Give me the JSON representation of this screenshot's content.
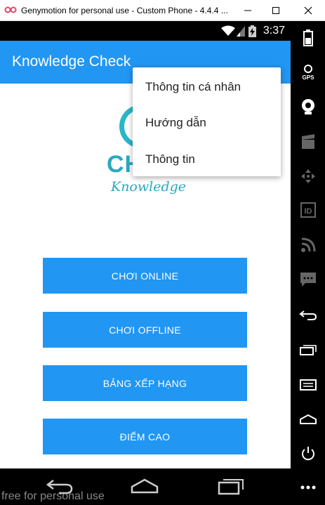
{
  "window": {
    "title": "Genymotion for personal use - Custom Phone - 4.4.4 ...",
    "controls": [
      "minimize-icon",
      "maximize-icon",
      "close-icon"
    ]
  },
  "status_bar": {
    "time": "3:37",
    "icons": [
      "wifi-icon",
      "signal-icon",
      "battery-charging-icon"
    ]
  },
  "app_bar": {
    "title": "Knowledge Check"
  },
  "logo": {
    "line1": "CHECK",
    "line2": "Knowledge"
  },
  "buttons": [
    {
      "label": "CHƠI ONLINE"
    },
    {
      "label": "CHƠI OFFLINE"
    },
    {
      "label": "BẢNG XẾP HẠNG"
    },
    {
      "label": "ĐIỂM CAO"
    }
  ],
  "popup_menu": {
    "items": [
      {
        "label": "Thông tin cá nhân"
      },
      {
        "label": "Hướng dẫn"
      },
      {
        "label": "Thông tin"
      }
    ]
  },
  "nav_bar": {
    "icons": [
      "back-icon",
      "home-icon",
      "recent-apps-icon"
    ]
  },
  "sidebar": {
    "icons": [
      "battery-icon",
      "gps-icon",
      "webcam-icon",
      "clapper-icon",
      "dpad-icon",
      "id-icon",
      "rss-icon",
      "sms-icon",
      "back-icon",
      "recent-apps-icon",
      "menu-icon",
      "home-icon",
      "power-icon",
      "more-icon"
    ],
    "gps_label": "GPS",
    "id_label": "ID"
  },
  "watermark": "free for personal use",
  "colors": {
    "primary": "#2196f3",
    "logo": "#2aa9bd",
    "status_bar": "#000000"
  }
}
